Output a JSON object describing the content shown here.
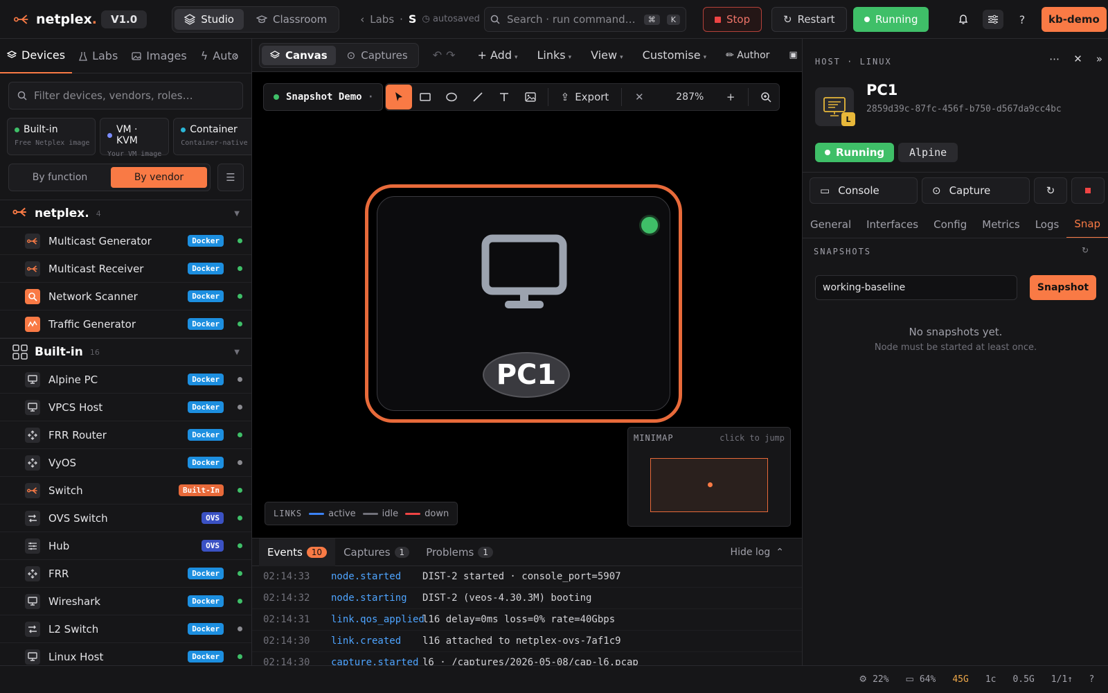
{
  "app": {
    "logo": "netplex",
    "version": "V1.0"
  },
  "topbar": {
    "modes": [
      "Studio",
      "Classroom"
    ],
    "breadcrumb": {
      "parent": "Labs",
      "current": "S",
      "status": "autosaved"
    },
    "search_placeholder": "Search · run command…",
    "search_keys": [
      "⌘",
      "K"
    ],
    "stop_label": "Stop",
    "restart_label": "Restart",
    "running_label": "Running",
    "user": "kb-demo"
  },
  "sidebar": {
    "tabs": [
      "Devices",
      "Labs",
      "Images",
      "Auto"
    ],
    "filter_placeholder": "Filter devices, vendors, roles…",
    "categories": [
      {
        "title": "Built-in",
        "sub": "Free Netplex image",
        "color": "#3fbf68"
      },
      {
        "title": "VM · KVM",
        "sub": "Your VM image",
        "color": "#7b8cff"
      },
      {
        "title": "Container",
        "sub": "Container-native",
        "color": "#2bb6d6"
      }
    ],
    "view_toggle": [
      "By function",
      "By vendor"
    ],
    "groups": [
      {
        "name": "netplex.",
        "count": "4",
        "devices": [
          {
            "name": "Multicast Generator",
            "badge": "Docker",
            "icon": "netplex-icon",
            "status": "#3fbf68"
          },
          {
            "name": "Multicast Receiver",
            "badge": "Docker",
            "icon": "netplex-icon",
            "status": "#3fbf68"
          },
          {
            "name": "Network Scanner",
            "badge": "Docker",
            "icon": "scanner-icon",
            "status": "#3fbf68"
          },
          {
            "name": "Traffic Generator",
            "badge": "Docker",
            "icon": "traffic-icon",
            "status": "#3fbf68"
          }
        ]
      },
      {
        "name": "Built-in",
        "count": "16",
        "devices": [
          {
            "name": "Alpine PC",
            "badge": "Docker",
            "icon": "monitor-icon",
            "status": "#8a8a90"
          },
          {
            "name": "VPCS Host",
            "badge": "Docker",
            "icon": "monitor-icon",
            "status": "#8a8a90"
          },
          {
            "name": "FRR Router",
            "badge": "Docker",
            "icon": "router-icon",
            "status": "#3fbf68"
          },
          {
            "name": "VyOS",
            "badge": "Docker",
            "icon": "router-icon",
            "status": "#8a8a90"
          },
          {
            "name": "Switch",
            "badge": "Built-In",
            "icon": "netplex-icon",
            "status": "#3fbf68"
          },
          {
            "name": "OVS Switch",
            "badge": "OVS",
            "icon": "switch-icon",
            "status": "#3fbf68"
          },
          {
            "name": "Hub",
            "badge": "OVS",
            "icon": "hub-icon",
            "status": "#3fbf68"
          },
          {
            "name": "FRR",
            "badge": "Docker",
            "icon": "router-icon",
            "status": "#3fbf68"
          },
          {
            "name": "Wireshark",
            "badge": "Docker",
            "icon": "monitor-icon",
            "status": "#3fbf68"
          },
          {
            "name": "L2 Switch",
            "badge": "Docker",
            "icon": "switch-icon",
            "status": "#8a8a90"
          },
          {
            "name": "Linux Host",
            "badge": "Docker",
            "icon": "monitor-icon",
            "status": "#3fbf68"
          }
        ]
      }
    ]
  },
  "canvas": {
    "tabs": [
      "Canvas",
      "Captures"
    ],
    "menus": [
      "+ Add",
      "Links",
      "View",
      "Customise",
      "✏ Author"
    ],
    "lab_name": "Snapshot Demo",
    "export_label": "Export",
    "zoom": "287%",
    "node_label": "PC1",
    "minimap": {
      "title": "MINIMAP",
      "hint": "click to jump"
    },
    "links_legend": {
      "title": "LINKS",
      "items": [
        {
          "label": "active",
          "color": "#3b82f6"
        },
        {
          "label": "idle",
          "color": "#71717a"
        },
        {
          "label": "down",
          "color": "#ef4444"
        }
      ]
    }
  },
  "log": {
    "tabs": [
      {
        "label": "Events",
        "count": "10"
      },
      {
        "label": "Captures",
        "count": "1"
      },
      {
        "label": "Problems",
        "count": "1"
      }
    ],
    "hide_label": "Hide log",
    "rows": [
      {
        "time": "02:14:33",
        "event": "node.started",
        "msg": "DIST-2 started · console_port=5907"
      },
      {
        "time": "02:14:32",
        "event": "node.starting",
        "msg": "DIST-2 (veos-4.30.3M) booting"
      },
      {
        "time": "02:14:31",
        "event": "link.qos_applied",
        "msg": "l16 delay=0ms loss=0% rate=40Gbps"
      },
      {
        "time": "02:14:30",
        "event": "link.created",
        "msg": "l16 attached to netplex-ovs-7af1c9"
      },
      {
        "time": "02:14:30",
        "event": "capture.started",
        "msg": "l6 · /captures/2026-05-08/cap-l6.pcap"
      }
    ]
  },
  "inspector": {
    "header": "HOST · LINUX",
    "name": "PC1",
    "id": "2859d39c-87fc-456f-b750-d567da9cc4bc",
    "badge_letter": "L",
    "status": "Running",
    "os": "Alpine",
    "actions": [
      "Console",
      "Capture"
    ],
    "tabs": [
      "General",
      "Interfaces",
      "Config",
      "Metrics",
      "Logs",
      "Snap"
    ],
    "snapshots_title": "SNAPSHOTS",
    "snapshot_input": "working-baseline",
    "snapshot_button": "Snapshot",
    "empty_title": "No snapshots yet.",
    "empty_sub": "Node must be started at least once."
  },
  "statusbar": {
    "cpu": "22%",
    "mem": "64%",
    "disk": "45G",
    "cores": "1c",
    "load": "0.5G",
    "nodes": "1/1↑",
    "help": "?"
  }
}
